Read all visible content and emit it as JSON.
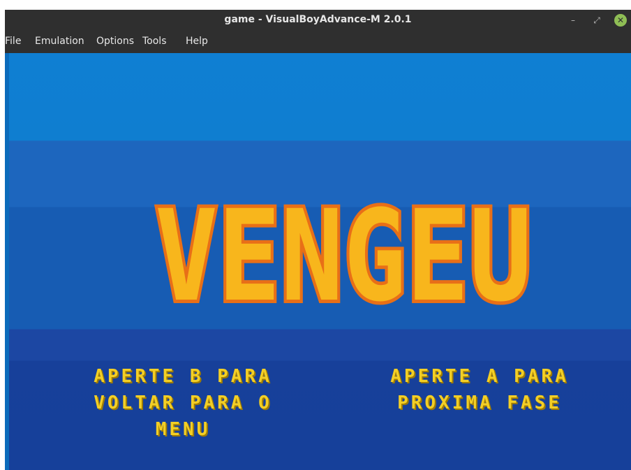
{
  "window": {
    "title": "game - VisualBoyAdvance-M 2.0.1",
    "controls": {
      "minimize": "–",
      "maximize": "⤢",
      "close": "✕"
    }
  },
  "menubar": {
    "items": [
      "File",
      "Emulation",
      "Options",
      "Tools",
      "Help"
    ]
  },
  "game": {
    "banner": "VENGEU",
    "left_message": [
      "APERTE B PARA",
      "VOLTAR PARA O",
      "MENU"
    ],
    "right_message": [
      "APERTE A PARA",
      "PROXIMA FASE"
    ],
    "colors": {
      "text_yellow": "#f3cf25",
      "banner_fill": "#f8b61c",
      "banner_outline": "#e86f17",
      "sky_top": "#0f7fd3",
      "sky_bottom": "#16409a"
    }
  }
}
